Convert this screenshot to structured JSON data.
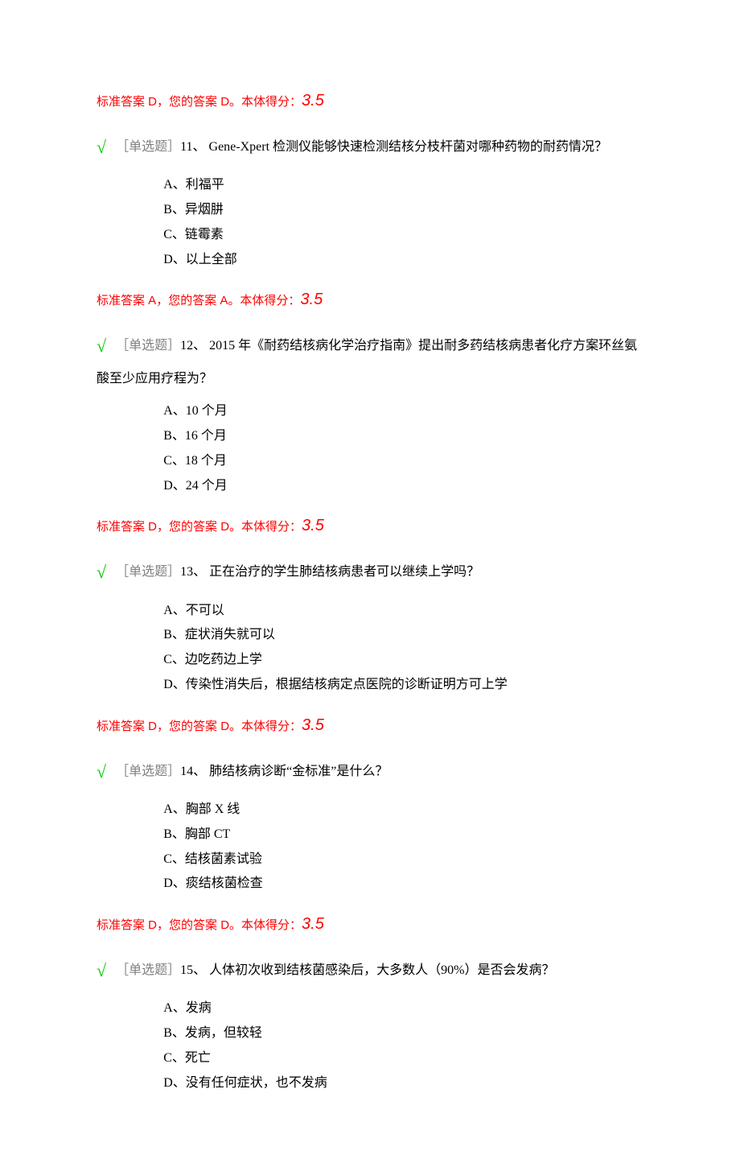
{
  "questions": [
    {
      "answer_line": {
        "correct": "D",
        "yours": "D",
        "score": "3.5"
      },
      "number": "11、",
      "type_label": "［单选题］",
      "text": " Gene-Xpert 检测仪能够快速检测结核分枝杆菌对哪种药物的耐药情况？",
      "options": [
        "A、利福平",
        "B、异烟肼",
        "C、链霉素",
        "D、以上全部"
      ]
    },
    {
      "answer_line": {
        "correct": "A",
        "yours": "A",
        "score": "3.5"
      },
      "number": "12、",
      "type_label": "［单选题］",
      "text": " 2015 年《耐药结核病化学治疗指南》提出耐多药结核病患者化疗方案环丝氨酸至少应用疗程为？",
      "options": [
        "A、10 个月",
        "B、16 个月",
        "C、18 个月",
        "D、24 个月"
      ]
    },
    {
      "answer_line": {
        "correct": "D",
        "yours": "D",
        "score": "3.5"
      },
      "number": "13、",
      "type_label": "［单选题］",
      "text": " 正在治疗的学生肺结核病患者可以继续上学吗？",
      "options": [
        "A、不可以",
        "B、症状消失就可以",
        "C、边吃药边上学",
        "D、传染性消失后，根据结核病定点医院的诊断证明方可上学"
      ]
    },
    {
      "answer_line": {
        "correct": "D",
        "yours": "D",
        "score": "3.5"
      },
      "number": "14、",
      "type_label": "［单选题］",
      "text": " 肺结核病诊断“金标准”是什么？",
      "options": [
        "A、胸部 X 线",
        "B、胸部 CT",
        "C、结核菌素试验",
        "D、痰结核菌检查"
      ]
    },
    {
      "answer_line": {
        "correct": "D",
        "yours": "D",
        "score": "3.5"
      },
      "number": "15、",
      "type_label": "［单选题］",
      "text": " 人体初次收到结核菌感染后，大多数人（90%）是否会发病？",
      "options": [
        "A、发病",
        "B、发病，但较轻",
        "C、死亡",
        "D、没有任何症状，也不发病"
      ]
    }
  ],
  "labels": {
    "check": "√",
    "answer_prefix": "标准答案 ",
    "answer_mid": "，您的答案 ",
    "answer_suffix": "。本体得分："
  }
}
